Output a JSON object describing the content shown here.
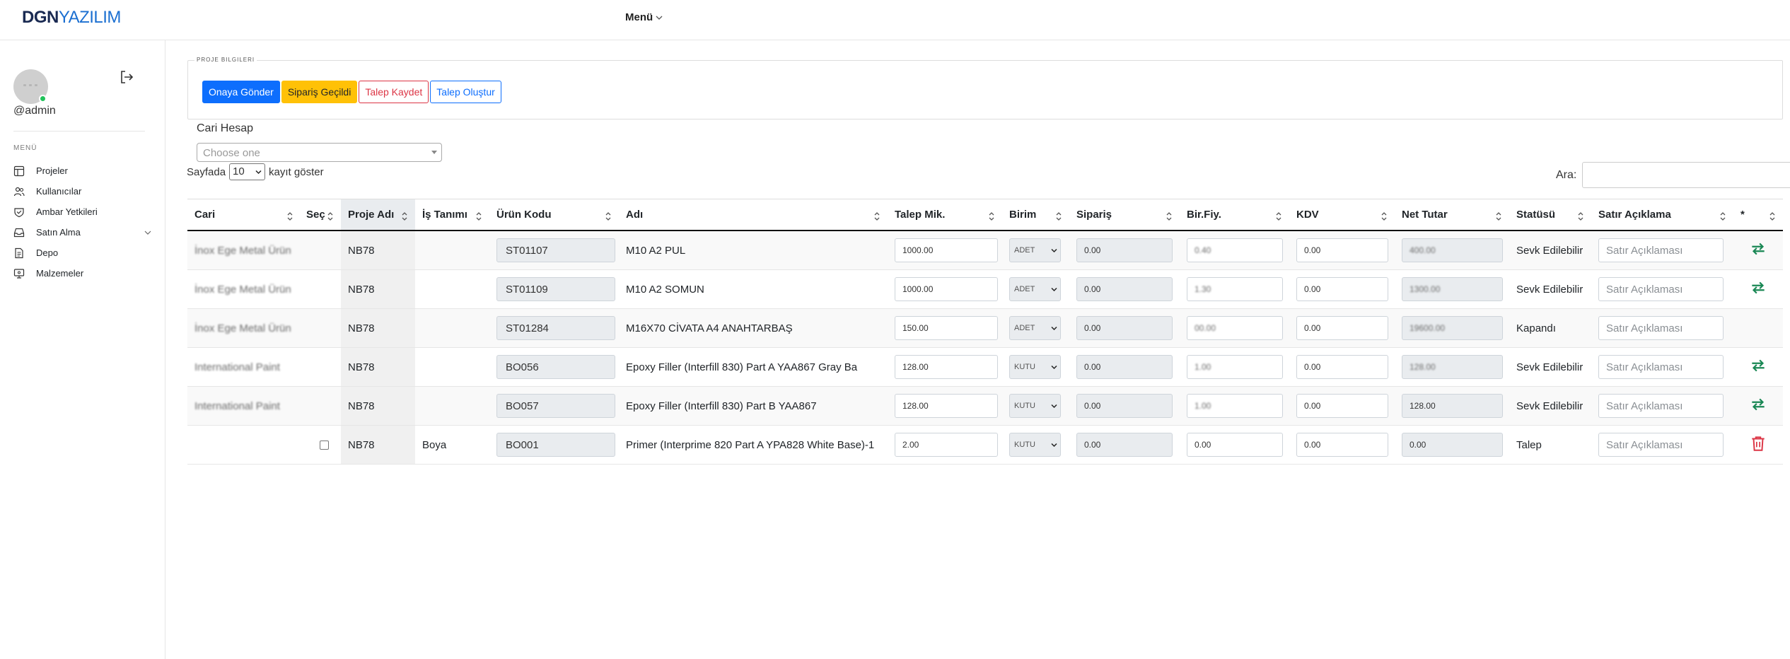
{
  "brand": {
    "bold": "DGN",
    "light": "YAZILIM"
  },
  "top_menu": {
    "label": "Menü"
  },
  "user": {
    "username": "@admin"
  },
  "sidebar": {
    "menu_title": "MENÜ",
    "items": [
      {
        "label": "Projeler",
        "icon": "table-icon"
      },
      {
        "label": "Kullanıcılar",
        "icon": "users-icon"
      },
      {
        "label": "Ambar Yetkileri",
        "icon": "shield-check-icon"
      },
      {
        "label": "Satın Alma",
        "icon": "inbox-icon",
        "expandable": true
      },
      {
        "label": "Depo",
        "icon": "document-icon"
      },
      {
        "label": "Malzemeler",
        "icon": "monitor-icon"
      }
    ]
  },
  "project_info": {
    "legend": "PROJE BILGILERI",
    "buttons": {
      "send_approval": "Onaya Gönder",
      "order_placed": "Sipariş Geçildi",
      "save_request": "Talep Kaydet",
      "create_request": "Talep Oluştur"
    }
  },
  "cari": {
    "label": "Cari Hesap",
    "placeholder": "Choose one"
  },
  "length": {
    "prefix": "Sayfada",
    "value": "10",
    "suffix": "kayıt göster"
  },
  "search": {
    "label": "Ara:"
  },
  "table": {
    "headers": {
      "cari": "Cari",
      "sec": "Seç",
      "proje": "Proje Adı",
      "is": "İş Tanımı",
      "urun": "Ürün Kodu",
      "adi": "Adı",
      "talep": "Talep Mik.",
      "birim": "Birim",
      "siparis": "Sipariş",
      "biryf": "Bir.Fiy.",
      "kdv": "KDV",
      "net": "Net Tutar",
      "statu": "Statüsü",
      "aciklama": "Satır Açıklama",
      "star": "*"
    },
    "line_note_placeholder": "Satır Açıklaması",
    "rows": [
      {
        "cari": "İnox Ege Metal Ürün",
        "proje": "NB78",
        "is": "",
        "urun": "ST01107",
        "adi": "M10 A2 PUL",
        "talep": "1000.00",
        "birim": "ADET",
        "siparis": "0.00",
        "biryf": "0.40",
        "kdv": "0.00",
        "net": "400.00",
        "statu": "Sevk Edilebilir",
        "action": "swap",
        "checkbox": false
      },
      {
        "cari": "İnox Ege Metal Ürün",
        "proje": "NB78",
        "is": "",
        "urun": "ST01109",
        "adi": "M10 A2 SOMUN",
        "talep": "1000.00",
        "birim": "ADET",
        "siparis": "0.00",
        "biryf": "1.30",
        "kdv": "0.00",
        "net": "1300.00",
        "statu": "Sevk Edilebilir",
        "action": "swap",
        "checkbox": false
      },
      {
        "cari": "İnox Ege Metal Ürün",
        "proje": "NB78",
        "is": "",
        "urun": "ST01284",
        "adi": "M16X70 CİVATA A4 ANAHTARBAŞ",
        "talep": "150.00",
        "birim": "ADET",
        "siparis": "0.00",
        "biryf": "00.00",
        "kdv": "0.00",
        "net": "19600.00",
        "statu": "Kapandı",
        "action": "none",
        "checkbox": false
      },
      {
        "cari": "International Paint",
        "proje": "NB78",
        "is": "",
        "urun": "BO056",
        "adi": "Epoxy Filler (Interfill 830) Part A YAA867 Gray Ba",
        "talep": "128.00",
        "birim": "KUTU",
        "siparis": "0.00",
        "biryf": "1.00",
        "kdv": "0.00",
        "net": "128.00",
        "statu": "Sevk Edilebilir",
        "action": "swap",
        "checkbox": false
      },
      {
        "cari": "International Paint",
        "proje": "NB78",
        "is": "",
        "urun": "BO057",
        "adi": "Epoxy Filler (Interfill 830) Part B YAA867",
        "talep": "128.00",
        "birim": "KUTU",
        "siparis": "0.00",
        "biryf": "1.00",
        "kdv": "0.00",
        "net": "128.00",
        "statu": "Sevk Edilebilir",
        "action": "swap",
        "checkbox": false
      },
      {
        "cari": "",
        "proje": "NB78",
        "is": "Boya",
        "urun": "BO001",
        "adi": "Primer (Interprime 820 Part A YPA828 White Base)-1",
        "talep": "2.00",
        "birim": "KUTU",
        "siparis": "0.00",
        "biryf": "0.00",
        "kdv": "0.00",
        "net": "0.00",
        "statu": "Talep",
        "action": "delete",
        "checkbox": true
      }
    ]
  },
  "colors": {
    "primary": "#0d6efd",
    "warning": "#ffc107",
    "danger": "#dc3545",
    "success": "#198754"
  }
}
